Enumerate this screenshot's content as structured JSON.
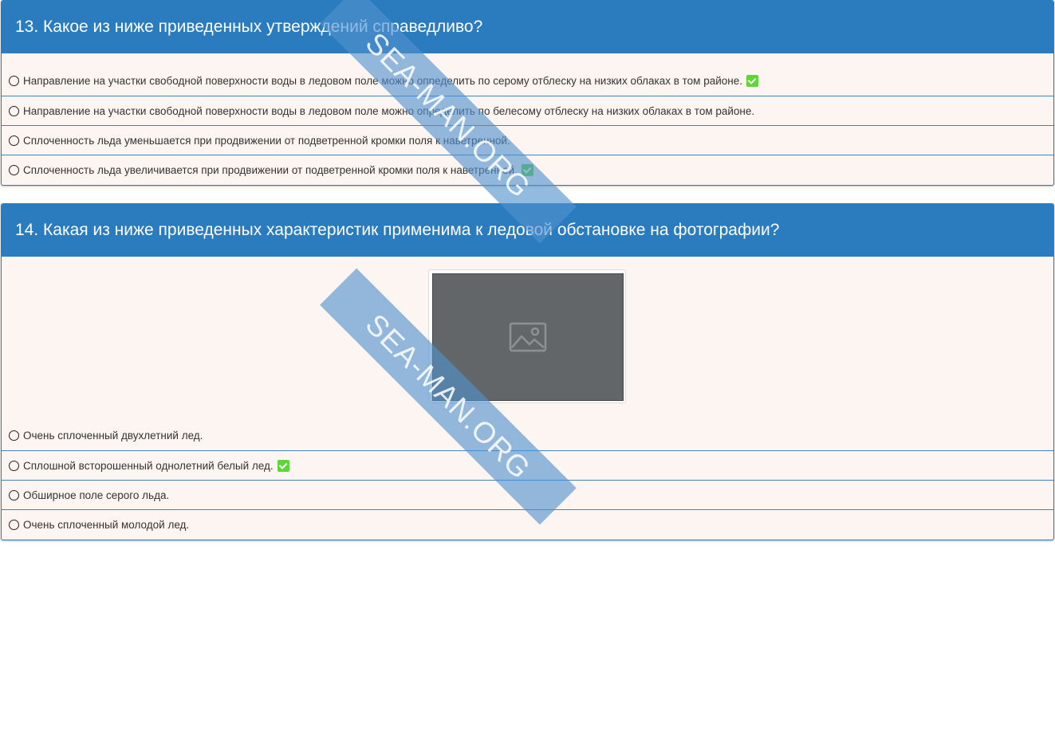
{
  "questions": [
    {
      "title": "13. Какое из ниже приведенных утверждений справедливо?",
      "answers": [
        {
          "text": "Направление на участки свободной поверхности воды в ледовом поле можно определить по серому отблеску на низких облаках в том районе.",
          "correct": true
        },
        {
          "text": "Направление на участки свободной поверхности воды в ледовом поле можно определить по белесому отблеску на низких облаках в том районе.",
          "correct": false
        },
        {
          "text": "Сплоченность льда уменьшается при продвижении от подветренной кромки поля к наветренной.",
          "correct": false
        },
        {
          "text": "Сплоченность льда увеличивается при продвижении от подветренной кромки поля к наветренной.",
          "correct": true
        }
      ]
    },
    {
      "title": "14. Какая из ниже приведенных характеристик применима к ледовой обстановке на фотографии?",
      "answers": [
        {
          "text": "Очень сплоченный двухлетний лед.",
          "correct": false
        },
        {
          "text": "Сплошной всторошенный однолетний белый лед.",
          "correct": true
        },
        {
          "text": "Обширное поле серого льда.",
          "correct": false
        },
        {
          "text": "Очень сплоченный молодой лед.",
          "correct": false
        }
      ]
    }
  ],
  "watermark": "SEA-MAN.ORG",
  "icons": {
    "correct": "check-icon",
    "photo": "image-placeholder-icon"
  },
  "colors": {
    "header": "#2b7bbf",
    "card_bg": "#fdf5f2",
    "correct_badge": "#5fd637"
  }
}
